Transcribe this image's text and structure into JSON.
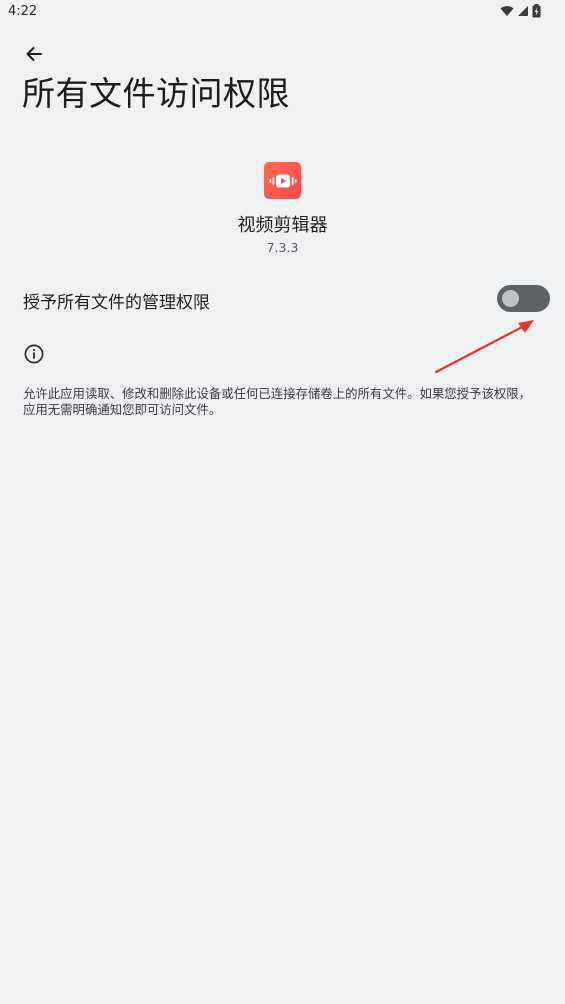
{
  "status_bar": {
    "time": "4:22",
    "icons": [
      "wifi-icon",
      "signal-icon",
      "battery-charging-icon"
    ]
  },
  "header": {
    "back_icon": "arrow-back-icon",
    "title": "所有文件访问权限"
  },
  "app": {
    "icon": "video-editor-app-icon",
    "name": "视频剪辑器",
    "version": "7.3.3"
  },
  "permission": {
    "label": "授予所有文件的管理权限",
    "toggle_on": false
  },
  "info": {
    "icon": "info-icon",
    "description": "允许此应用读取、修改和删除此设备或任何已连接存储卷上的所有文件。如果您授予该权限，应用无需明确通知您即可访问文件。"
  },
  "annotation": {
    "type": "red-arrow",
    "color": "#e8322b",
    "points_to": "toggle"
  },
  "colors": {
    "background": "#f0f1f3",
    "toggle_track_off": "#5d6166",
    "toggle_thumb_off": "#bfc2c6",
    "app_icon_gradient_start": "#ff6a4e",
    "app_icon_gradient_end": "#f24a52"
  }
}
